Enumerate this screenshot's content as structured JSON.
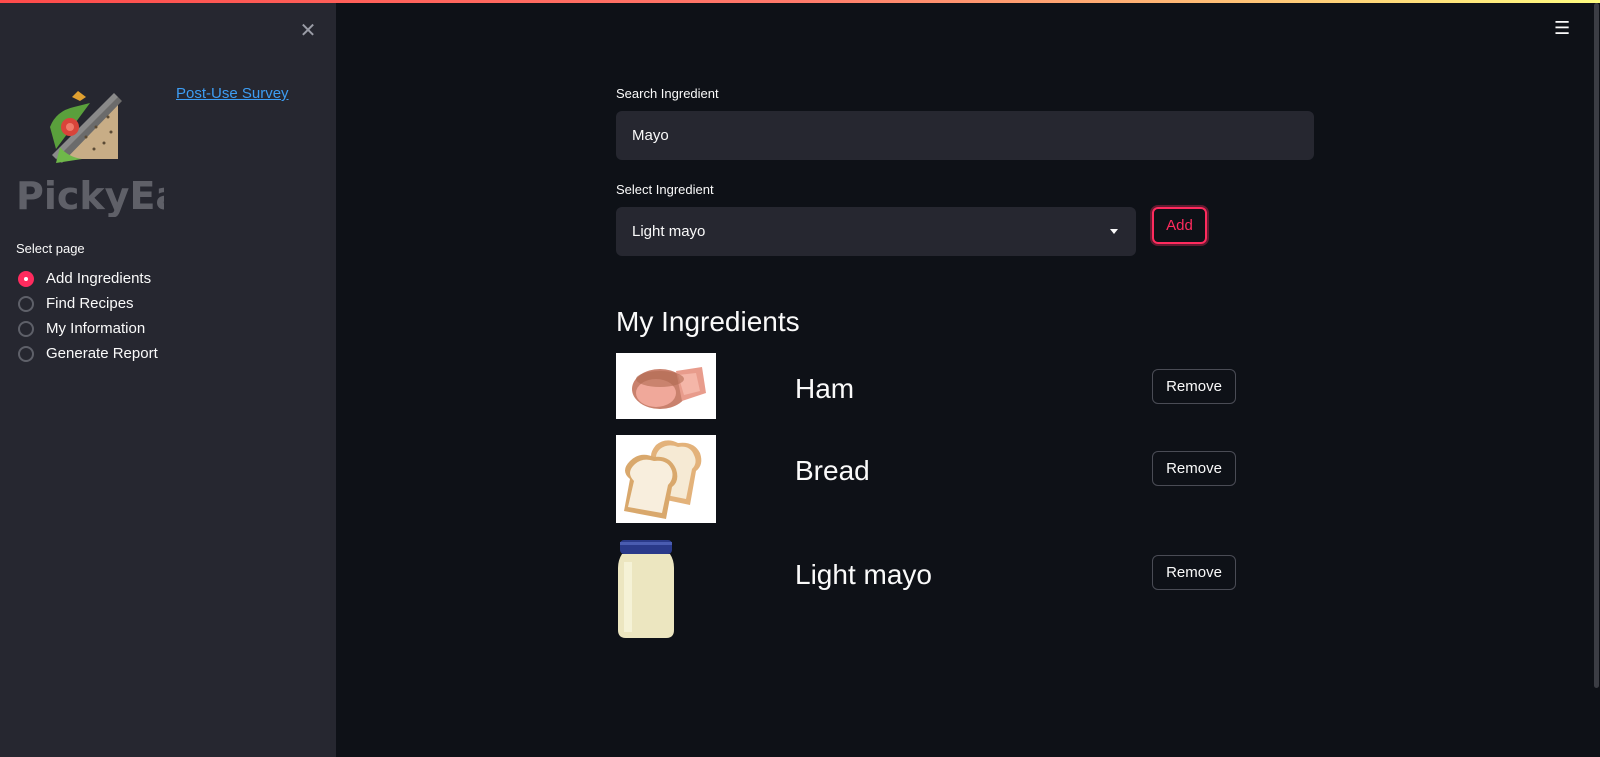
{
  "sidebar": {
    "close_icon": "close-icon",
    "brand": "PickyEats",
    "survey_link": "Post-Use Survey",
    "select_page_label": "Select page",
    "pages": [
      {
        "label": "Add Ingredients",
        "selected": true
      },
      {
        "label": "Find Recipes",
        "selected": false
      },
      {
        "label": "My Information",
        "selected": false
      },
      {
        "label": "Generate Report",
        "selected": false
      }
    ]
  },
  "main": {
    "menu_icon": "hamburger-menu-icon",
    "search": {
      "label": "Search Ingredient",
      "value": "Mayo"
    },
    "select": {
      "label": "Select Ingredient",
      "value": "Light mayo"
    },
    "add_button": "Add",
    "section_title": "My Ingredients",
    "ingredients": [
      {
        "name": "Ham",
        "image": "ham-image",
        "remove_label": "Remove"
      },
      {
        "name": "Bread",
        "image": "bread-image",
        "remove_label": "Remove"
      },
      {
        "name": "Light mayo",
        "image": "mayo-jar-image",
        "remove_label": "Remove"
      }
    ]
  },
  "colors": {
    "background": "#0e1117",
    "sidebar": "#262730",
    "accent": "#ff2b5e",
    "link": "#3d9df3"
  }
}
